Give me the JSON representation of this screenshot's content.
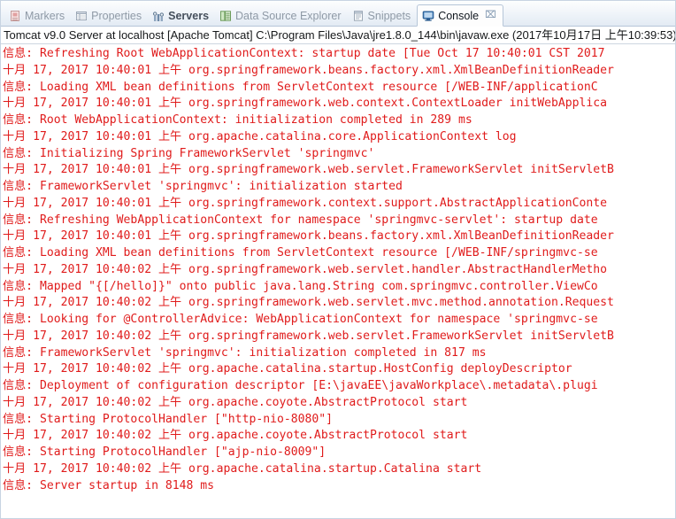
{
  "tabs": [
    {
      "label": "Markers",
      "icon": "markers-icon",
      "active": false,
      "bold": false
    },
    {
      "label": "Properties",
      "icon": "properties-icon",
      "active": false,
      "bold": false
    },
    {
      "label": "Servers",
      "icon": "servers-icon",
      "active": false,
      "bold": true
    },
    {
      "label": "Data Source Explorer",
      "icon": "data-source-explorer-icon",
      "active": false,
      "bold": false
    },
    {
      "label": "Snippets",
      "icon": "snippets-icon",
      "active": false,
      "bold": false
    },
    {
      "label": "Console",
      "icon": "console-icon",
      "active": true,
      "bold": false,
      "close": "⌧"
    }
  ],
  "console": {
    "header": "Tomcat v9.0 Server at localhost [Apache Tomcat] C:\\Program Files\\Java\\jre1.8.0_144\\bin\\javaw.exe (2017年10月17日 上午10:39:53)",
    "log_color": "#e01b1b",
    "lines": [
      "信息: Refreshing Root WebApplicationContext: startup date [Tue Oct 17 10:40:01 CST 2017",
      "十月 17, 2017 10:40:01 上午 org.springframework.beans.factory.xml.XmlBeanDefinitionReader",
      "信息: Loading XML bean definitions from ServletContext resource [/WEB-INF/applicationC",
      "十月 17, 2017 10:40:01 上午 org.springframework.web.context.ContextLoader initWebApplica",
      "信息: Root WebApplicationContext: initialization completed in 289 ms",
      "十月 17, 2017 10:40:01 上午 org.apache.catalina.core.ApplicationContext log",
      "信息: Initializing Spring FrameworkServlet 'springmvc'",
      "十月 17, 2017 10:40:01 上午 org.springframework.web.servlet.FrameworkServlet initServletB",
      "信息: FrameworkServlet 'springmvc': initialization started",
      "十月 17, 2017 10:40:01 上午 org.springframework.context.support.AbstractApplicationConte",
      "信息: Refreshing WebApplicationContext for namespace 'springmvc-servlet': startup date",
      "十月 17, 2017 10:40:01 上午 org.springframework.beans.factory.xml.XmlBeanDefinitionReader",
      "信息: Loading XML bean definitions from ServletContext resource [/WEB-INF/springmvc-se",
      "十月 17, 2017 10:40:02 上午 org.springframework.web.servlet.handler.AbstractHandlerMetho",
      "信息: Mapped \"{[/hello]}\" onto public java.lang.String com.springmvc.controller.ViewCo",
      "十月 17, 2017 10:40:02 上午 org.springframework.web.servlet.mvc.method.annotation.Request",
      "信息: Looking for @ControllerAdvice: WebApplicationContext for namespace 'springmvc-se",
      "十月 17, 2017 10:40:02 上午 org.springframework.web.servlet.FrameworkServlet initServletB",
      "信息: FrameworkServlet 'springmvc': initialization completed in 817 ms",
      "十月 17, 2017 10:40:02 上午 org.apache.catalina.startup.HostConfig deployDescriptor",
      "信息: Deployment of configuration descriptor [E:\\javaEE\\javaWorkplace\\.metadata\\.plugi",
      "十月 17, 2017 10:40:02 上午 org.apache.coyote.AbstractProtocol start",
      "信息: Starting ProtocolHandler [\"http-nio-8080\"]",
      "十月 17, 2017 10:40:02 上午 org.apache.coyote.AbstractProtocol start",
      "信息: Starting ProtocolHandler [\"ajp-nio-8009\"]",
      "十月 17, 2017 10:40:02 上午 org.apache.catalina.startup.Catalina start",
      "信息: Server startup in 8148 ms"
    ]
  }
}
